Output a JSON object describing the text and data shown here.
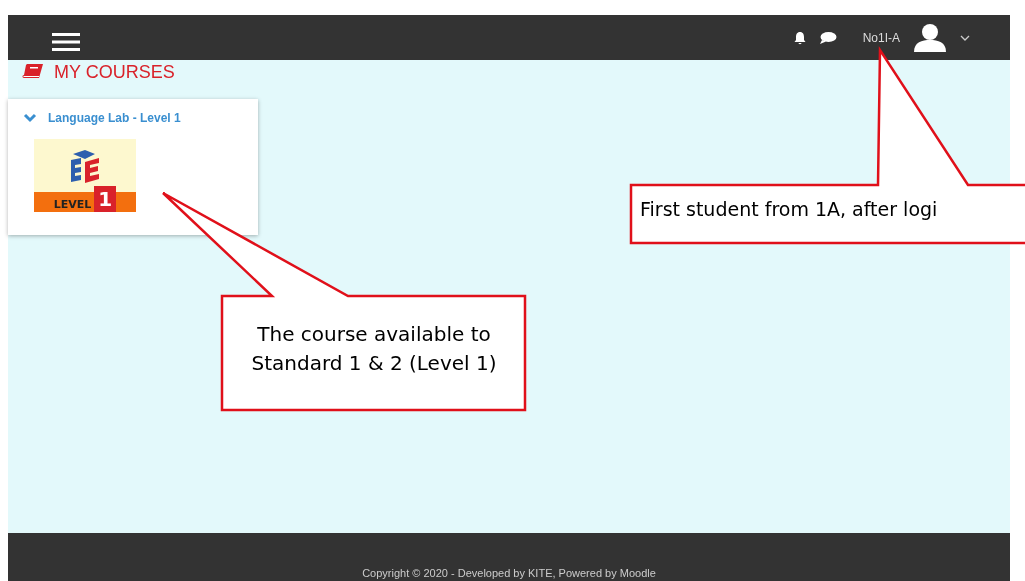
{
  "navbar": {
    "user_name": "No1I-A"
  },
  "page_title": "MY COURSES",
  "courses": [
    {
      "title": "Language Lab - Level 1",
      "expanded": true,
      "image_label": "LEVEL",
      "image_number": "1"
    }
  ],
  "callouts": [
    {
      "text": "First student from 1A, after logi",
      "kind": "user"
    },
    {
      "text": "The course available to Standard 1 & 2 (Level 1)",
      "kind": "course"
    }
  ],
  "footer": {
    "text": "Copyright © 2020 - Developed by KITE, Powered by Moodle"
  }
}
